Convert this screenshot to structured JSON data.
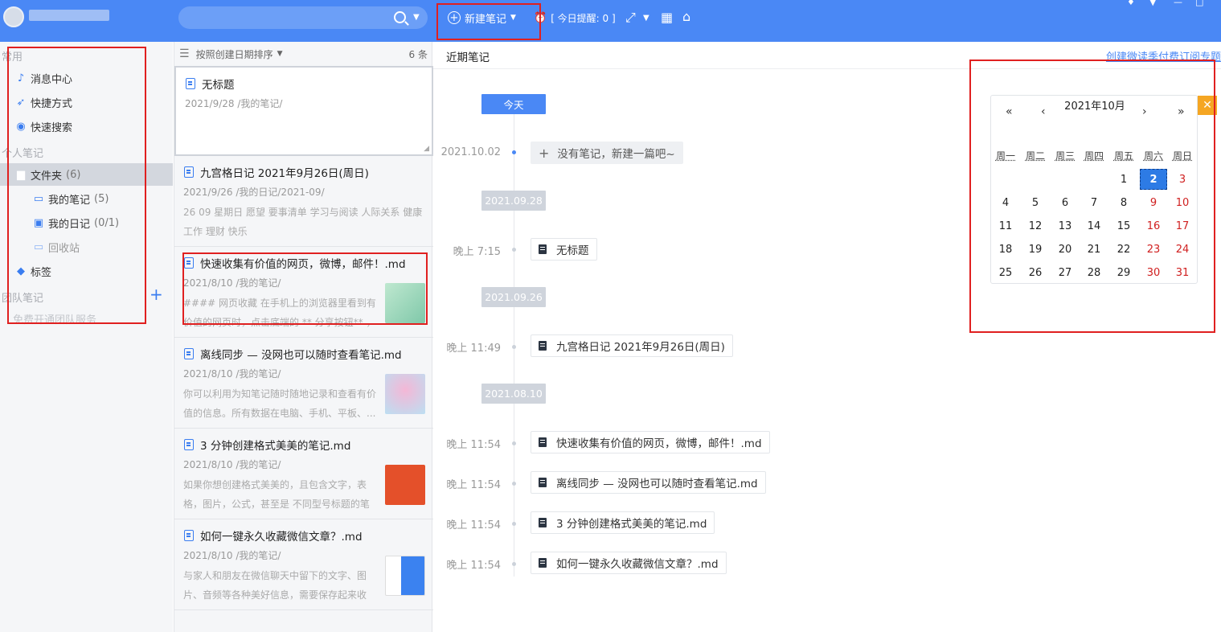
{
  "topbar": {
    "new_note_label": "新建笔记",
    "reminder_label": "[ 今日提醒: 0 ]",
    "icons": [
      "search-icon",
      "plus-circle-icon",
      "alarm-icon",
      "expand-icon",
      "grid-icon",
      "home-icon"
    ]
  },
  "sidebar": {
    "section_common": "常用",
    "message_center": "消息中心",
    "shortcuts": "快捷方式",
    "quick_search": "快速搜索",
    "section_personal": "个人笔记",
    "folder_label": "文件夹",
    "folder_count": "(6)",
    "my_notes": "我的笔记",
    "my_notes_count": "(5)",
    "my_diary": "我的日记",
    "my_diary_count": "(0/1)",
    "recycle": "回收站",
    "tags": "标签",
    "section_team": "团队笔记",
    "team_free": "免费开通团队服务"
  },
  "list": {
    "sort_label": "按照创建日期排序",
    "count_label": "6 条",
    "cards": [
      {
        "title": "无标题",
        "meta": "2021/9/28  /我的笔记/",
        "snippet": ""
      },
      {
        "title": "九宫格日记 2021年9月26日(周日)",
        "meta": "2021/9/26  /我的日记/2021-09/",
        "snippet": " 26 09 星期日 愿望 要事清单 学习与阅读 人际关系 健康 工作 理财 快乐"
      },
      {
        "title": "快速收集有价值的网页，微博，邮件！.md",
        "meta": "2021/8/10  /我的笔记/",
        "snippet": "#### 网页收藏 在手机上的浏览器里看到有价值的网页时，点击底端的 ** 分享按钮** ，选"
      },
      {
        "title": "离线同步 — 没网也可以随时查看笔记.md",
        "meta": "2021/8/10  /我的笔记/",
        "snippet": "你可以利用为知笔记随时随地记录和查看有价值的信息。所有数据在电脑、手机、平板、..."
      },
      {
        "title": "3 分钟创建格式美美的笔记.md",
        "meta": "2021/8/10  /我的笔记/",
        "snippet": "如果你想创建格式美美的，且包含文字，表格，图片，公式，甚至是 不同型号标题的笔记..."
      },
      {
        "title": "如何一键永久收藏微信文章？.md",
        "meta": "2021/8/10  /我的笔记/",
        "snippet": " 与家人和朋友在微信聊天中留下的文字、图片、音频等各种美好信息，需要保存起来收好？..."
      }
    ]
  },
  "main": {
    "title": "近期笔记",
    "promo_link": "创建微读季付费订阅专题",
    "today_label": "今天",
    "today_date": "2021.10.02",
    "empty_entry": "没有笔记，新建一篇吧~",
    "groups": [
      {
        "date": "2021.09.28",
        "entries": [
          {
            "time": "晚上 7:15",
            "title": "无标题"
          }
        ]
      },
      {
        "date": "2021.09.26",
        "entries": [
          {
            "time": "晚上 11:49",
            "title": "九宫格日记 2021年9月26日(周日)"
          }
        ]
      },
      {
        "date": "2021.08.10",
        "entries": [
          {
            "time": "晚上 11:54",
            "title": "快速收集有价值的网页，微博，邮件！.md"
          },
          {
            "time": "晚上 11:54",
            "title": "离线同步 — 没网也可以随时查看笔记.md"
          },
          {
            "time": "晚上 11:54",
            "title": "3 分钟创建格式美美的笔记.md"
          },
          {
            "time": "晚上 11:54",
            "title": "如何一键永久收藏微信文章？.md"
          }
        ]
      }
    ]
  },
  "calendar": {
    "title": "2021年10月",
    "prev_year": "«",
    "prev_month": "‹",
    "next_month": "›",
    "next_year": "»",
    "weekdays": [
      "周一",
      "周二",
      "周三",
      "周四",
      "周五",
      "周六",
      "周日"
    ],
    "selected_day": 2,
    "start_weekday_index": 4,
    "days_in_month": 31,
    "weekend_color": "#d02020",
    "selected_color": "#2d7be5"
  }
}
